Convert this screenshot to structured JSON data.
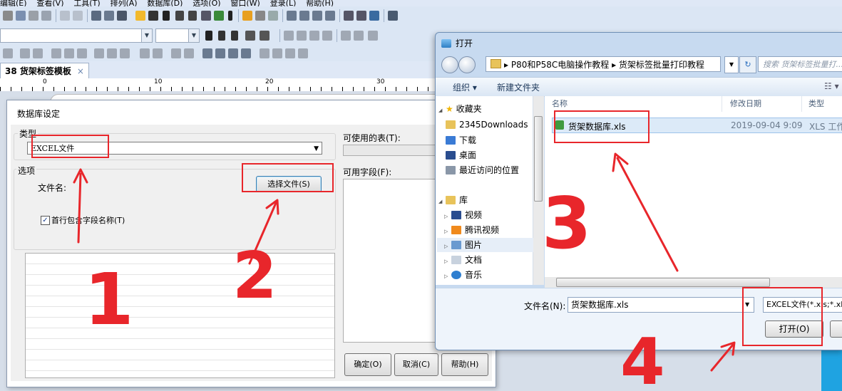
{
  "menu": [
    "编辑(E)",
    "查看(V)",
    "工具(T)",
    "排列(A)",
    "数据库(D)",
    "选项(O)",
    "窗口(W)",
    "登录(L)",
    "帮助(H)"
  ],
  "document_tab": {
    "title": "38 货架标签模板",
    "close": "×"
  },
  "ruler_numbers": [
    "0",
    "10",
    "20",
    "30"
  ],
  "db_dialog": {
    "title": "数据库设定",
    "type_label": "类型",
    "type_value": "EXCEL文件",
    "options_label": "选项",
    "filename_label": "文件名:",
    "choose_file_button": "选择文件(S)",
    "first_row_checkbox": "首行包含字段名称(T)",
    "first_row_checked": true,
    "tables_label": "可使用的表(T):",
    "fields_label": "可用字段(F):",
    "ok_button": "确定(O)",
    "cancel_button": "取消(C)",
    "help_button": "帮助(H)"
  },
  "open_dialog": {
    "title": "打开",
    "breadcrumb": [
      "P80和P58C电脑操作教程",
      "货架标签批量打印教程"
    ],
    "search_placeholder": "搜索 货架标签批量打...",
    "organize": "组织 ▾",
    "new_folder": "新建文件夹",
    "favorites_header": "收藏夹",
    "favorites": [
      "2345Downloads",
      "下载",
      "桌面",
      "最近访问的位置"
    ],
    "libraries_header": "库",
    "libraries": [
      "视频",
      "腾讯视频",
      "图片",
      "文档",
      "音乐"
    ],
    "columns": {
      "name": "名称",
      "date": "修改日期",
      "type": "类型"
    },
    "files": [
      {
        "name": "货架数据库.xls",
        "date": "2019-09-04 9:09",
        "type": "XLS 工作"
      }
    ],
    "filename_label": "文件名(N):",
    "filename_value": "货架数据库.xls",
    "filetype_value": "EXCEL文件(*.xls;*.xlsx)",
    "open_button": "打开(O)",
    "cancel_button": ""
  },
  "annotations": [
    "1",
    "2",
    "3",
    "4"
  ],
  "colors": {
    "annotation_red": "#e8262b",
    "accent_blue": "#1fa3e1"
  }
}
